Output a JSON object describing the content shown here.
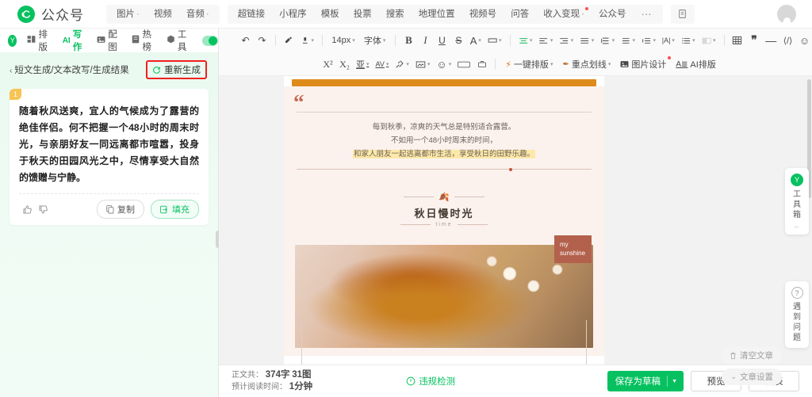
{
  "brand": {
    "name": "公众号",
    "logo_icon": "spiral-logo-icon"
  },
  "topnav": {
    "group1": [
      {
        "label": "图片",
        "has_caret": true
      },
      {
        "label": "视频",
        "has_caret": false
      },
      {
        "label": "音频",
        "has_caret": true
      }
    ],
    "group2": [
      {
        "label": "超链接",
        "has_caret": false
      },
      {
        "label": "小程序",
        "has_caret": false
      },
      {
        "label": "模板",
        "has_caret": false
      },
      {
        "label": "投票",
        "has_caret": false
      },
      {
        "label": "搜索",
        "has_caret": false
      },
      {
        "label": "地理位置",
        "has_caret": false
      },
      {
        "label": "视频号",
        "has_caret": false
      },
      {
        "label": "问答",
        "has_caret": false
      },
      {
        "label": "收入变现",
        "has_caret": true,
        "dot": true
      },
      {
        "label": "公众号",
        "has_caret": false
      }
    ],
    "more": "···",
    "export_icon": "export-doc-icon",
    "avatar_icon": "user-avatar-icon"
  },
  "toolbar": {
    "row1": [
      {
        "name": "undo-button",
        "glyph": "↶"
      },
      {
        "name": "redo-button",
        "glyph": "↷"
      },
      {
        "sep": true
      },
      {
        "name": "format-painter-button",
        "glyph": "🖌"
      },
      {
        "name": "clear-format-button",
        "glyph": "🧹",
        "caret": true
      },
      {
        "sep": true
      },
      {
        "name": "font-size-select",
        "text": "14px",
        "caret": true
      },
      {
        "name": "font-family-select",
        "text": "字体",
        "caret": true
      },
      {
        "sep": true
      },
      {
        "name": "bold-button",
        "glyph": "B"
      },
      {
        "name": "italic-button",
        "glyph": "I"
      },
      {
        "name": "underline-button",
        "glyph": "U"
      },
      {
        "name": "strikethrough-button",
        "glyph": "S"
      },
      {
        "name": "text-color-button",
        "glyph": "A",
        "caret": true
      },
      {
        "name": "highlight-color-button",
        "glyph": "▭",
        "caret": true
      },
      {
        "sep": true
      },
      {
        "name": "align-center-button",
        "glyph": "≡",
        "green": true,
        "caret": true
      },
      {
        "name": "align-left-button",
        "glyph": "≡",
        "caret": true
      },
      {
        "name": "align-right-button",
        "glyph": "≡",
        "caret": true
      },
      {
        "name": "align-justify-button",
        "glyph": "≡",
        "caret": true
      },
      {
        "name": "line-height-button",
        "glyph": "≑",
        "caret": true
      },
      {
        "name": "paragraph-spacing-button",
        "glyph": "≖",
        "caret": true
      },
      {
        "name": "indent-button",
        "glyph": "⇥",
        "caret": true
      },
      {
        "name": "letter-spacing-button",
        "glyph": "|A|",
        "caret": true
      },
      {
        "name": "bullet-list-button",
        "glyph": "☰",
        "caret": true
      },
      {
        "name": "background-button",
        "glyph": "▣",
        "caret": true,
        "muted": true
      },
      {
        "sep": true
      },
      {
        "name": "insert-table-button",
        "glyph": "▦"
      },
      {
        "name": "quote-button",
        "glyph": "❞"
      },
      {
        "name": "divider-button",
        "glyph": "—"
      },
      {
        "name": "source-code-button",
        "glyph": "⟨/⟩"
      },
      {
        "name": "emoji-button",
        "glyph": "☺"
      }
    ],
    "row2": [
      {
        "name": "superscript-button",
        "glyph": "X²"
      },
      {
        "name": "subscript-button",
        "glyph": "X₂"
      },
      {
        "name": "text-box-button",
        "glyph": "亚",
        "caret": true
      },
      {
        "name": "char-spacing-button",
        "glyph": "AV",
        "caret": true
      },
      {
        "name": "eraser-button",
        "glyph": "✎",
        "caret": true
      },
      {
        "name": "insert-card-button",
        "glyph": "▭",
        "caret": true
      },
      {
        "name": "sticker-button",
        "glyph": "☺",
        "caret": true
      },
      {
        "name": "html-button",
        "glyph": "HTML"
      },
      {
        "name": "toolbox-button",
        "glyph": "🧰"
      },
      {
        "sep": true
      },
      {
        "name": "one-click-layout-button",
        "icon": "lightning-icon",
        "text": "一键排版",
        "caret": true,
        "orange": true
      },
      {
        "name": "key-underline-button",
        "icon": "pen-icon",
        "text": "重点划线",
        "caret": true,
        "orange": true
      },
      {
        "name": "image-design-button",
        "icon": "image-icon",
        "text": "图片设计",
        "dot": true
      },
      {
        "name": "ai-layout-button",
        "icon": "ai-icon",
        "text": "AI排版"
      }
    ]
  },
  "sidebar": {
    "tabs": [
      {
        "label": "排版",
        "icon": "layout-icon",
        "active": false
      },
      {
        "label": "写作",
        "icon": "ai-write-icon",
        "active": true,
        "prefix": "AI"
      },
      {
        "label": "配图",
        "icon": "picture-icon",
        "active": false
      },
      {
        "label": "热榜",
        "icon": "hotlist-icon",
        "active": false
      },
      {
        "label": "工具",
        "icon": "tools-icon",
        "active": false
      }
    ],
    "toggle_on": true,
    "breadcrumb": "短文生成/文本改写/生成结果",
    "regenerate_label": "重新生成",
    "regenerate_icon": "refresh-icon",
    "result": {
      "index": "1",
      "text": "随着秋风送爽，宜人的气候成为了露营的绝佳伴侣。何不把握一个48小时的周末时光，与亲朋好友一同远离都市喧嚣，投身于秋天的田园风光之中，尽情享受大自然的馈赠与宁静。",
      "copy_label": "复制",
      "fill_label": "填充",
      "like_icon": "thumbs-up-icon",
      "dislike_icon": "thumbs-down-icon"
    }
  },
  "article": {
    "quote_mark": "“",
    "quote_lines": [
      {
        "text": "每到秋季，凉爽的天气总是特别适合露营。",
        "highlight": false
      },
      {
        "text": "不如用一个48小时周末的时间，",
        "highlight": false
      },
      {
        "text": "和家人朋友一起逃离都市生活，享受秋日的田野乐趣。",
        "highlight": true
      }
    ],
    "section_title": "秋日慢时光",
    "section_subtitle": "time",
    "leaf_icon": "leaf-icon",
    "photo_badge": "my\nsunshine",
    "photo_badge_line1": "my",
    "photo_badge_line2": "sunshine",
    "accent_orange": "#dd8c1c",
    "accent_rust": "#b3614c"
  },
  "bottombar": {
    "word_prefix": "正文共：",
    "word_count": "374字",
    "image_count": "31图",
    "read_prefix": "预计阅读时间：",
    "read_time": "1分钟",
    "check_label": "违规检测",
    "check_icon": "shield-check-icon",
    "save_label": "保存为草稿",
    "preview_label": "预览",
    "publish_label": "发表"
  },
  "dock": {
    "toolbox_label": "工具箱",
    "toolbox_badge_icon": "y-badge-icon",
    "toolbox_arrow": "←",
    "help_label": "遇到问题",
    "help_icon": "question-icon",
    "clear_label": "清空文章",
    "clear_icon": "trash-icon",
    "settings_label": "文章设置",
    "settings_icon": "chevron-double-down-icon"
  }
}
